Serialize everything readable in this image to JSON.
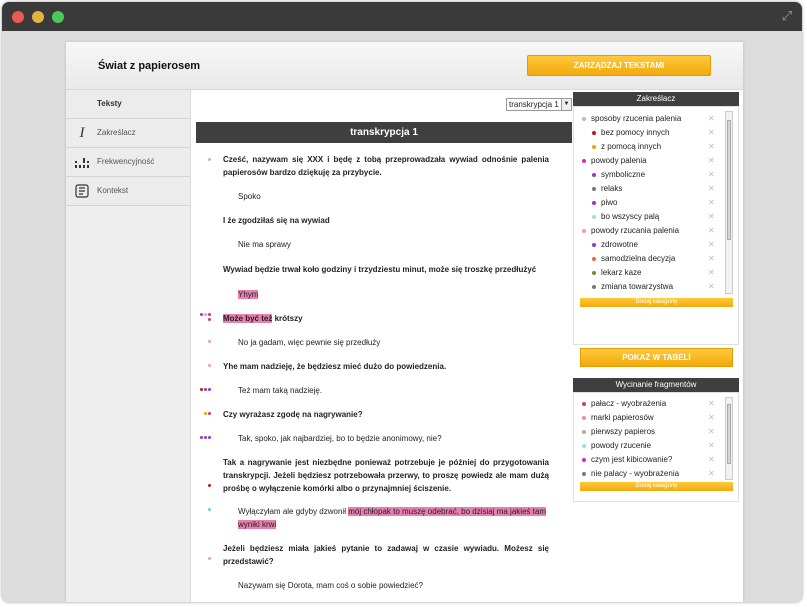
{
  "window": {
    "expand_icon": "expand-icon"
  },
  "header": {
    "title": "Świat z papierosem",
    "manage_button": "ZARZĄDZAJ TEKSTAMI"
  },
  "sidebar": {
    "items": [
      {
        "label": "Teksty",
        "icon": ""
      },
      {
        "label": "Zakreślacz",
        "icon": "I"
      },
      {
        "label": "Frekwencyjność",
        "icon": "▪▪▪"
      },
      {
        "label": "Kontekst",
        "icon": "⚙"
      }
    ]
  },
  "main": {
    "select_value": "transkrypcja 1",
    "transcript_title": "transkrypcja 1",
    "lines": [
      {
        "type": "q",
        "text": "Cześć, nazywam się XXX i będę z tobą przeprowadzała wywiad odnośnie palenia papierosów bardzo dziękuję za przybycie."
      },
      {
        "type": "a",
        "text": "Spoko"
      },
      {
        "type": "q",
        "text": "I że zgodziłaś się na wywiad"
      },
      {
        "type": "a",
        "text": "Nie ma sprawy"
      },
      {
        "type": "q",
        "text": "Wywiad będzie trwał koło godziny i trzydziestu minut, może się troszkę przedłużyć"
      },
      {
        "type": "a",
        "text": "Yhym"
      },
      {
        "type": "q",
        "pre": "Może być też",
        "post": " krótszy"
      },
      {
        "type": "a",
        "text": "No ja gadam, więc pewnie się przedłuży"
      },
      {
        "type": "q",
        "text": "Yhe mam nadzieję, że będziesz mieć dużo do powiedzenia."
      },
      {
        "type": "a",
        "text": "Też mam taką nadzieję."
      },
      {
        "type": "q",
        "text": "Czy wyrażasz zgodę na nagrywanie?"
      },
      {
        "type": "a",
        "text": "Tak, spoko, jak najbardziej, bo to będzie anonimowy, nie?"
      },
      {
        "type": "q",
        "text": "Tak a nagrywanie jest niezbędne ponieważ potrzebuje je później do przygotowania transkrypcji. Jeżeli będziesz potrzebowała przerwy, to proszę powiedz ale mam dużą prośbę o wyłączenie komórki albo o przynajmniej ściszenie."
      },
      {
        "type": "a",
        "pre": "Wyłączyłam ale gdyby dzwonił ",
        "hl": "mój chłopak to muszę odebrać, bo dzisiaj ma jakieś tam wyniki krwi"
      },
      {
        "type": "q",
        "text": "Jeżeli będziesz miała jakieś pytanie to zadawaj w czasie wywiadu. Możesz się przedstawić?"
      },
      {
        "type": "a",
        "text": "Nazywam się Dorota, mam coś o sobie powiedzieć?"
      }
    ]
  },
  "zakreslacz": {
    "title": "Zakreślacz",
    "items": [
      {
        "label": "sposoby rzucenia palenia",
        "color": "#bbbbbb",
        "level": 0
      },
      {
        "label": "bez pomocy innych",
        "color": "#cc1111",
        "level": 1
      },
      {
        "label": "z pomocą innych",
        "color": "#e8a800",
        "level": 1
      },
      {
        "label": "powody palenia",
        "color": "#cc33aa",
        "level": 0
      },
      {
        "label": "symboliczne",
        "color": "#9933cc",
        "level": 1
      },
      {
        "label": "relaks",
        "color": "#777777",
        "level": 1
      },
      {
        "label": "piwo",
        "color": "#9933cc",
        "level": 1
      },
      {
        "label": "bo wszyscy palą",
        "color": "#99ddee",
        "level": 1
      },
      {
        "label": "powody rzucania palenia",
        "color": "#ee99cc",
        "level": 0
      },
      {
        "label": "zdrowotne",
        "color": "#9933cc",
        "level": 1
      },
      {
        "label": "samodzielna decyzja",
        "color": "#ee6644",
        "level": 1
      },
      {
        "label": "lekarz kaze",
        "color": "#778833",
        "level": 1
      },
      {
        "label": "zmiana towarzystwa",
        "color": "#777777",
        "level": 1
      }
    ],
    "add_category": "Dodaj kategorię",
    "show_table": "POKAŻ W TABELI"
  },
  "wycinanie": {
    "title": "Wycinanie fragmentów",
    "items": [
      {
        "label": "pałacz - wyobrażenia",
        "color": "#cc4444"
      },
      {
        "label": "marki papierosów",
        "color": "#ee88bb"
      },
      {
        "label": "pierwszy papieros",
        "color": "#aaaaaa"
      },
      {
        "label": "powody rzucenie",
        "color": "#99ddee"
      },
      {
        "label": "czym jest kibicowanie?",
        "color": "#cc33aa"
      },
      {
        "label": "nie palacy - wyobrażenia",
        "color": "#777777"
      }
    ],
    "add_category": "Dodaj kategorię"
  }
}
